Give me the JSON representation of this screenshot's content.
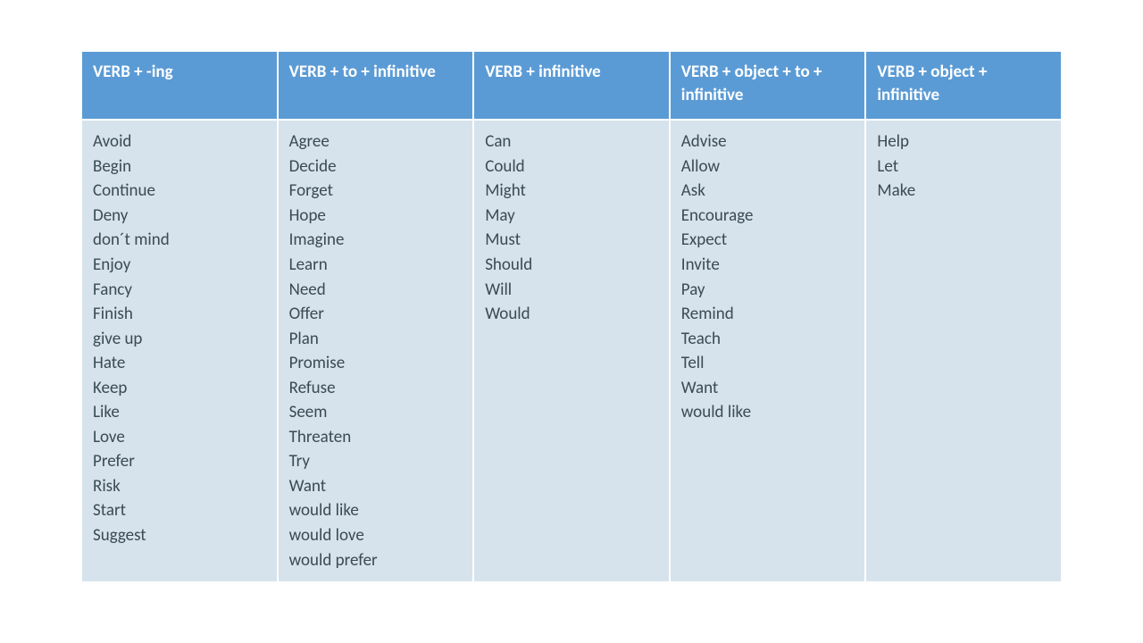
{
  "table": {
    "headers": [
      "VERB + -ing",
      "VERB + to + infinitive",
      "VERB + infinitive",
      "VERB + object + to + infinitive",
      "VERB + object + infinitive"
    ],
    "columns": [
      [
        "Avoid",
        "Begin",
        "Continue",
        "Deny",
        "don´t mind",
        "Enjoy",
        "Fancy",
        "Finish",
        "give up",
        "Hate",
        "Keep",
        "Like",
        "Love",
        "Prefer",
        "Risk",
        "Start",
        "Suggest"
      ],
      [
        "Agree",
        "Decide",
        "Forget",
        "Hope",
        "Imagine",
        "Learn",
        "Need",
        "Offer",
        "Plan",
        "Promise",
        "Refuse",
        "Seem",
        "Threaten",
        "Try",
        "Want",
        "would like",
        "would love",
        "would prefer"
      ],
      [
        "Can",
        "Could",
        "Might",
        "May",
        "Must",
        "Should",
        "Will",
        "Would"
      ],
      [
        "Advise",
        "Allow",
        "Ask",
        "Encourage",
        "Expect",
        "Invite",
        "Pay",
        "Remind",
        "Teach",
        "Tell",
        "Want",
        "would like"
      ],
      [
        "Help",
        "Let",
        "Make"
      ]
    ]
  }
}
